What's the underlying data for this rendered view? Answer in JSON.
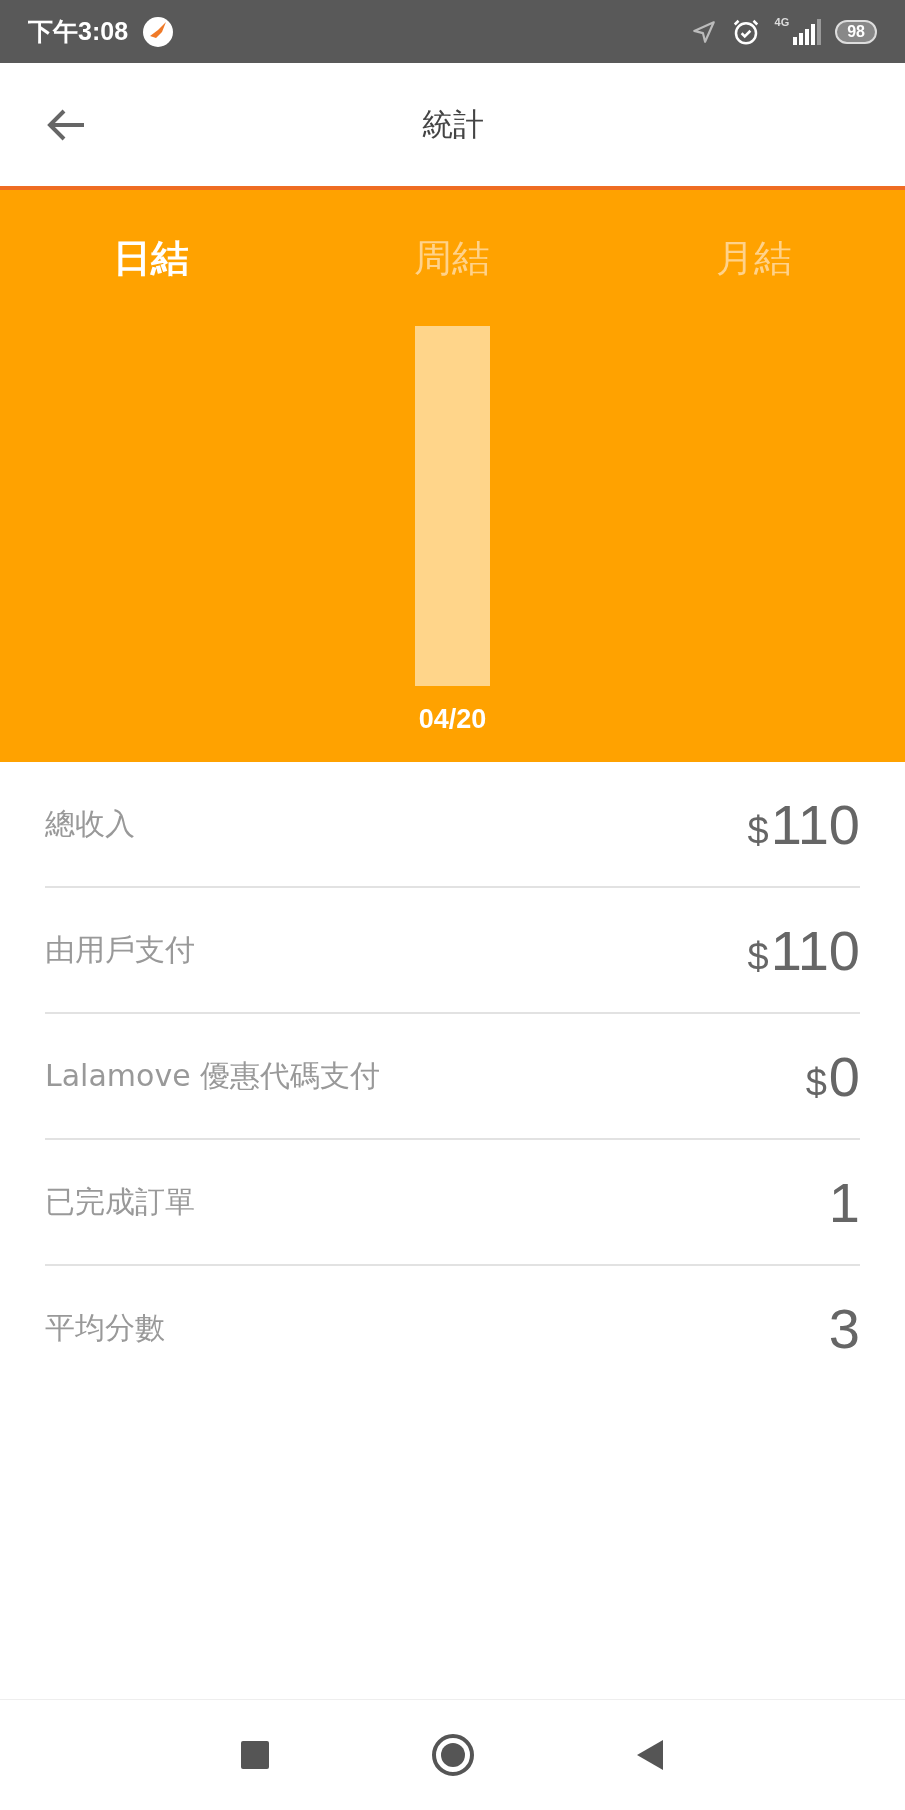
{
  "status_bar": {
    "time": "下午3:08",
    "network": "4G",
    "battery": "98"
  },
  "header": {
    "title": "統計"
  },
  "tabs": [
    {
      "label": "日結",
      "selected": true
    },
    {
      "label": "周結",
      "selected": false
    },
    {
      "label": "月結",
      "selected": false
    }
  ],
  "chart": {
    "date_label": "04/20"
  },
  "stats": [
    {
      "label": "總收入",
      "currency": "$",
      "amount": "110"
    },
    {
      "label": "由用戶支付",
      "currency": "$",
      "amount": "110"
    },
    {
      "label": "Lalamove 優惠代碼支付",
      "currency": "$",
      "amount": "0"
    },
    {
      "label": "已完成訂單",
      "amount": "1"
    },
    {
      "label": "平均分數",
      "amount": "3"
    }
  ]
}
